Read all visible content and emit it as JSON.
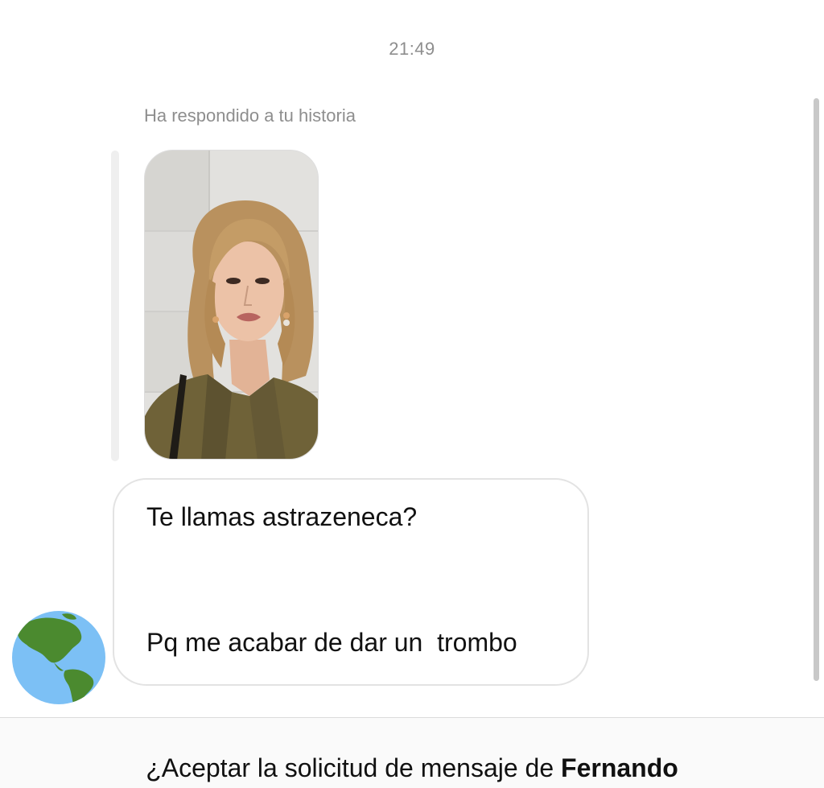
{
  "conversation": {
    "timestamp": "21:49",
    "reply_context": "Ha respondido a tu historia",
    "story_image_icon": "story-photo",
    "message": {
      "line1": "Te llamas astrazeneca?",
      "line2": "Pq me acabar de dar un  trombo"
    },
    "sender_avatar_icon": "globe-americas-emoji"
  },
  "request_banner": {
    "prefix": "¿Aceptar la solicitud de mensaje de ",
    "sender_name": "Fernando"
  },
  "colors": {
    "meta_text": "#8e8e8e",
    "bubble_border": "#e3e3e3",
    "reply_bar": "#efefef",
    "panel_bg": "#fafafa",
    "globe_ocean": "#7cc0f5",
    "globe_land": "#4b8a2f"
  }
}
